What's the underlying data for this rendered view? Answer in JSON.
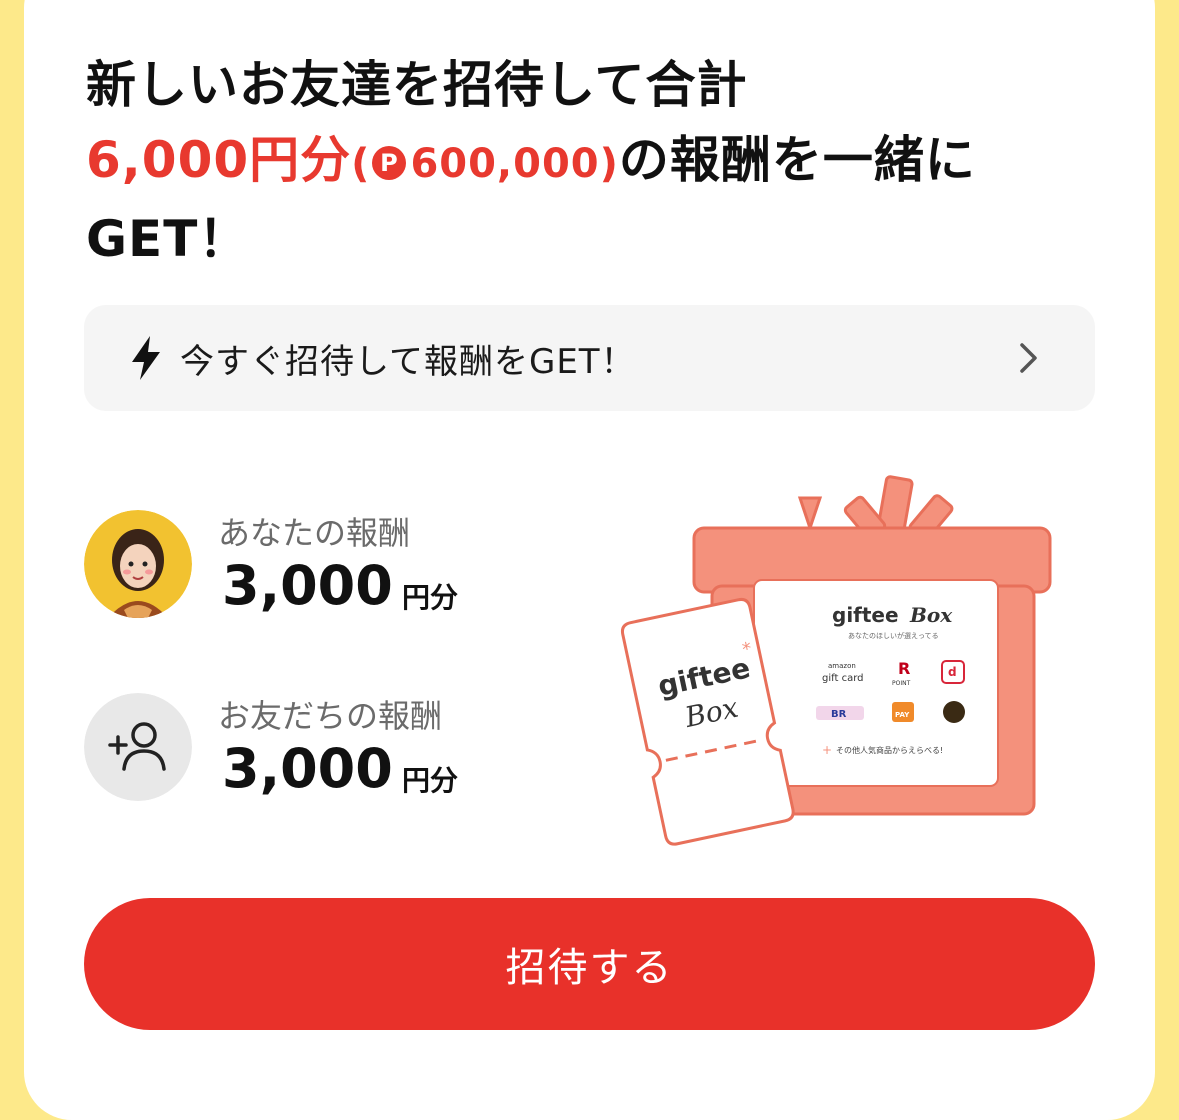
{
  "headline": {
    "line1": "新しいお友達を招待して合計",
    "amount_yen": "6,000円分",
    "paren_open": "(",
    "points_icon": "P",
    "points": "600,000",
    "paren_close": ")",
    "line2_rest": "の報酬を一緒に",
    "line3": "GET！"
  },
  "promo": {
    "icon": "lightning-bolt-icon",
    "text": "今すぐ招待して報酬をGET！",
    "chevron": "chevron-right-icon"
  },
  "rewards": [
    {
      "label": "あなたの報酬",
      "amount": "3,000",
      "unit": "円分",
      "icon": "user-avatar"
    },
    {
      "label": "お友だちの報酬",
      "amount": "3,000",
      "unit": "円分",
      "icon": "add-friend-icon"
    }
  ],
  "gift_illustration": {
    "ticket_brand": "giftee",
    "ticket_sub": "Box",
    "box_title": "giftee",
    "box_title_sub": "Box",
    "box_tagline": "あなたのほしいが選えってる",
    "brands": [
      "gift card",
      "POINT",
      "d POINT",
      "BR",
      "PAY",
      ""
    ],
    "brands_small": [
      "amazon",
      "R",
      "d",
      "",
      "",
      ""
    ],
    "more_text": "その他人気商品からえらべる!",
    "accent_color": "#f4917c"
  },
  "invite_button": {
    "label": "招待する",
    "color": "#e8312a"
  },
  "colors": {
    "background": "#fde98a",
    "accent_red": "#e8392f"
  }
}
